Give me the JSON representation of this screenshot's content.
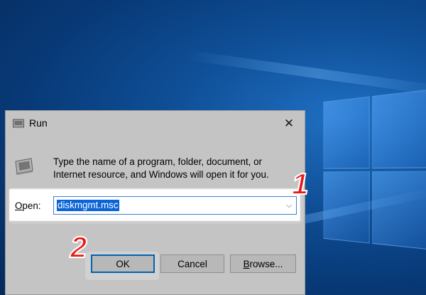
{
  "window": {
    "title": "Run",
    "close_glyph": "✕"
  },
  "description": "Type the name of a program, folder, document, or Internet resource, and Windows will open it for you.",
  "open_field": {
    "label_prefix": "",
    "label_underlined": "O",
    "label_rest": "pen:",
    "value": "diskmgmt.msc",
    "dropdown_glyph": "⌵"
  },
  "buttons": {
    "ok": "OK",
    "cancel": "Cancel",
    "browse_underlined": "B",
    "browse_rest": "rowse..."
  },
  "callouts": {
    "step1": "1",
    "step2": "2"
  },
  "colors": {
    "accent": "#0078d7",
    "selection": "#0a64d8",
    "callout": "#e81818",
    "desktop": "#0f4f97"
  },
  "icons": [
    "run-icon",
    "run-program-icon",
    "close-icon",
    "chevron-down-icon",
    "windows-logo-icon"
  ]
}
